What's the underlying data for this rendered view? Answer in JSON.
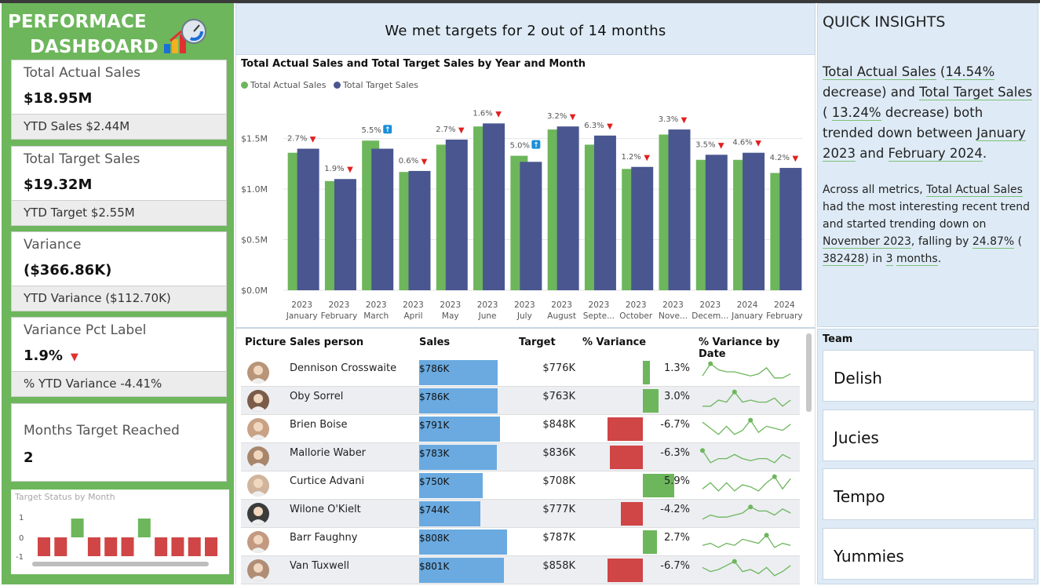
{
  "dashboard": {
    "title_line1": "PERFORMACE",
    "title_line2": "DASHBOARD",
    "headline": "We met targets for 2 out of 14 months"
  },
  "kpis": {
    "actual": {
      "label": "Total Actual Sales",
      "value": "$18.95M",
      "sub": "YTD Sales $2.44M"
    },
    "target": {
      "label": "Total Target Sales",
      "value": "$19.32M",
      "sub": "YTD Target $2.55M"
    },
    "variance": {
      "label": "Variance",
      "value": "($366.86K)",
      "sub": "YTD Variance ($112.70K)"
    },
    "variance_pct": {
      "label": "Variance Pct Label",
      "value": "1.9%",
      "arrow": "▼",
      "sub": "% YTD Variance -4.41%"
    },
    "months": {
      "label": "Months Target Reached",
      "value": "2"
    }
  },
  "mini_chart": {
    "title": "Target Status by Month",
    "y_ticks": [
      "1",
      "0",
      "-1"
    ],
    "values": [
      -1,
      -1,
      1,
      -1,
      -1,
      -1,
      1,
      -1,
      -1,
      -1,
      -1
    ],
    "colors": {
      "pos": "#6db65c",
      "neg": "#d04545"
    }
  },
  "chart_data": {
    "type": "bar",
    "title": "Total Actual Sales and Total Target Sales by Year and Month",
    "legend": [
      "Total Actual Sales",
      "Total Target Sales"
    ],
    "categories": [
      [
        "2023",
        "January"
      ],
      [
        "2023",
        "February"
      ],
      [
        "2023",
        "March"
      ],
      [
        "2023",
        "April"
      ],
      [
        "2023",
        "May"
      ],
      [
        "2023",
        "June"
      ],
      [
        "2023",
        "July"
      ],
      [
        "2023",
        "August"
      ],
      [
        "2023",
        "Septe..."
      ],
      [
        "2023",
        "October"
      ],
      [
        "2023",
        "Nove..."
      ],
      [
        "2023",
        "Decem..."
      ],
      [
        "2024",
        "January"
      ],
      [
        "2024",
        "February"
      ]
    ],
    "series": [
      {
        "name": "Total Actual Sales",
        "color": "#6db65c",
        "values": [
          1.36,
          1.08,
          1.48,
          1.17,
          1.44,
          1.62,
          1.33,
          1.59,
          1.44,
          1.2,
          1.54,
          1.29,
          1.29,
          1.16
        ]
      },
      {
        "name": "Total Target Sales",
        "color": "#4a5690",
        "values": [
          1.4,
          1.1,
          1.4,
          1.18,
          1.49,
          1.65,
          1.27,
          1.62,
          1.53,
          1.22,
          1.59,
          1.34,
          1.36,
          1.21
        ]
      }
    ],
    "data_labels": [
      "2.7%",
      "1.9%",
      "5.5%",
      "0.6%",
      "2.7%",
      "1.6%",
      "5.0%",
      "3.2%",
      "6.3%",
      "1.2%",
      "3.3%",
      "3.5%",
      "4.6%",
      "4.2%"
    ],
    "label_status": [
      "down",
      "down",
      "up",
      "down",
      "down",
      "down",
      "up",
      "down",
      "down",
      "down",
      "down",
      "down",
      "down",
      "down"
    ],
    "y_ticks": [
      "$0.0M",
      "$0.5M",
      "$1.0M",
      "$1.5M"
    ],
    "y_tick_values": [
      0,
      0.5,
      1.0,
      1.5
    ],
    "ylim": [
      0,
      1.8
    ],
    "grid": true,
    "legend_position": "top-left"
  },
  "table": {
    "headers": {
      "picture": "Picture",
      "person": "Sales person",
      "sales": "Sales",
      "target": "Target",
      "variance": "% Variance",
      "by_date": "% Variance by Date"
    },
    "rows": [
      {
        "name": "Dennison Crosswaite",
        "sales": "$786K",
        "sales_val": 786,
        "target": "$776K",
        "var": "1.3%",
        "var_val": 1.3,
        "spark": [
          3,
          9,
          6,
          5,
          5,
          4,
          3,
          4,
          7,
          2,
          2,
          4
        ],
        "hi": 1
      },
      {
        "name": "Oby Sorrel",
        "sales": "$786K",
        "sales_val": 786,
        "target": "$763K",
        "var": "3.0%",
        "var_val": 3.0,
        "spark": [
          2,
          2,
          5,
          4,
          9,
          4,
          5,
          4,
          4,
          6,
          2,
          5
        ],
        "hi": 4
      },
      {
        "name": "Brien Boise",
        "sales": "$791K",
        "sales_val": 791,
        "target": "$848K",
        "var": "-6.7%",
        "var_val": -6.7,
        "spark": [
          8,
          5,
          2,
          6,
          2,
          4,
          9,
          3,
          6,
          5,
          4,
          7
        ],
        "hi": 6
      },
      {
        "name": "Mallorie Waber",
        "sales": "$783K",
        "sales_val": 783,
        "target": "$836K",
        "var": "-6.3%",
        "var_val": -6.3,
        "spark": [
          8,
          2,
          4,
          4,
          6,
          4,
          3,
          4,
          4,
          2,
          6,
          4
        ],
        "hi": 0
      },
      {
        "name": "Curtice Advani",
        "sales": "$750K",
        "sales_val": 750,
        "target": "$708K",
        "var": "5.9%",
        "var_val": 5.9,
        "spark": [
          3,
          6,
          2,
          6,
          2,
          5,
          4,
          2,
          6,
          9,
          3,
          8
        ],
        "hi": 9
      },
      {
        "name": "Wilone O'Kielt",
        "sales": "$744K",
        "sales_val": 744,
        "target": "$777K",
        "var": "-4.2%",
        "var_val": -4.2,
        "spark": [
          2,
          4,
          3,
          3,
          4,
          5,
          8,
          6,
          6,
          4,
          7,
          5
        ],
        "hi": 6
      },
      {
        "name": "Barr Faughny",
        "sales": "$808K",
        "sales_val": 808,
        "target": "$787K",
        "var": "2.7%",
        "var_val": 2.7,
        "spark": [
          3,
          4,
          2,
          4,
          3,
          6,
          5,
          4,
          8,
          2,
          4,
          3
        ],
        "hi": 8
      },
      {
        "name": "Van Tuxwell",
        "sales": "$801K",
        "sales_val": 801,
        "target": "$858K",
        "var": "-6.7%",
        "var_val": -6.7,
        "spark": [
          6,
          4,
          5,
          7,
          9,
          4,
          5,
          3,
          6,
          2,
          4,
          7
        ],
        "hi": 4
      }
    ]
  },
  "insights": {
    "title": "QUICK INSIGHTS",
    "p1": [
      {
        "t": "Total Actual Sales",
        "u": true
      },
      {
        "t": " (",
        "u": false
      },
      {
        "t": "14.54%",
        "u": true
      },
      {
        "t": " decrease) and ",
        "u": false
      },
      {
        "t": "Total Target Sales",
        "u": true
      },
      {
        "t": " ( ",
        "u": false
      },
      {
        "t": "13.24%",
        "u": true
      },
      {
        "t": " decrease) both trended down between ",
        "u": false
      },
      {
        "t": "January 2023",
        "u": true
      },
      {
        "t": " and ",
        "u": false
      },
      {
        "t": "February 2024",
        "u": true
      },
      {
        "t": ".",
        "u": false
      }
    ],
    "p2": [
      {
        "t": "Across all metrics, ",
        "u": false
      },
      {
        "t": "Total Actual Sales",
        "u": true
      },
      {
        "t": " had the most interesting recent trend and started trending down on ",
        "u": false
      },
      {
        "t": "November 2023",
        "u": true
      },
      {
        "t": ", falling by ",
        "u": false
      },
      {
        "t": "24.87%",
        "u": true
      },
      {
        "t": " ( ",
        "u": false
      },
      {
        "t": "382428",
        "u": true
      },
      {
        "t": ") in ",
        "u": false
      },
      {
        "t": "3",
        "u": true
      },
      {
        "t": " ",
        "u": false
      },
      {
        "t": "months",
        "u": true
      },
      {
        "t": ".",
        "u": false
      }
    ]
  },
  "team": {
    "title": "Team",
    "items": [
      "Delish",
      "Jucies",
      "Tempo",
      "Yummies"
    ]
  },
  "colors": {
    "green": "#6db65c",
    "navy": "#4a5690",
    "red": "#d04545",
    "blue_bar": "#6aaae0",
    "panel": "#deebf6",
    "up_badge": "#1b8fd8",
    "down_arrow": "#e02020"
  }
}
